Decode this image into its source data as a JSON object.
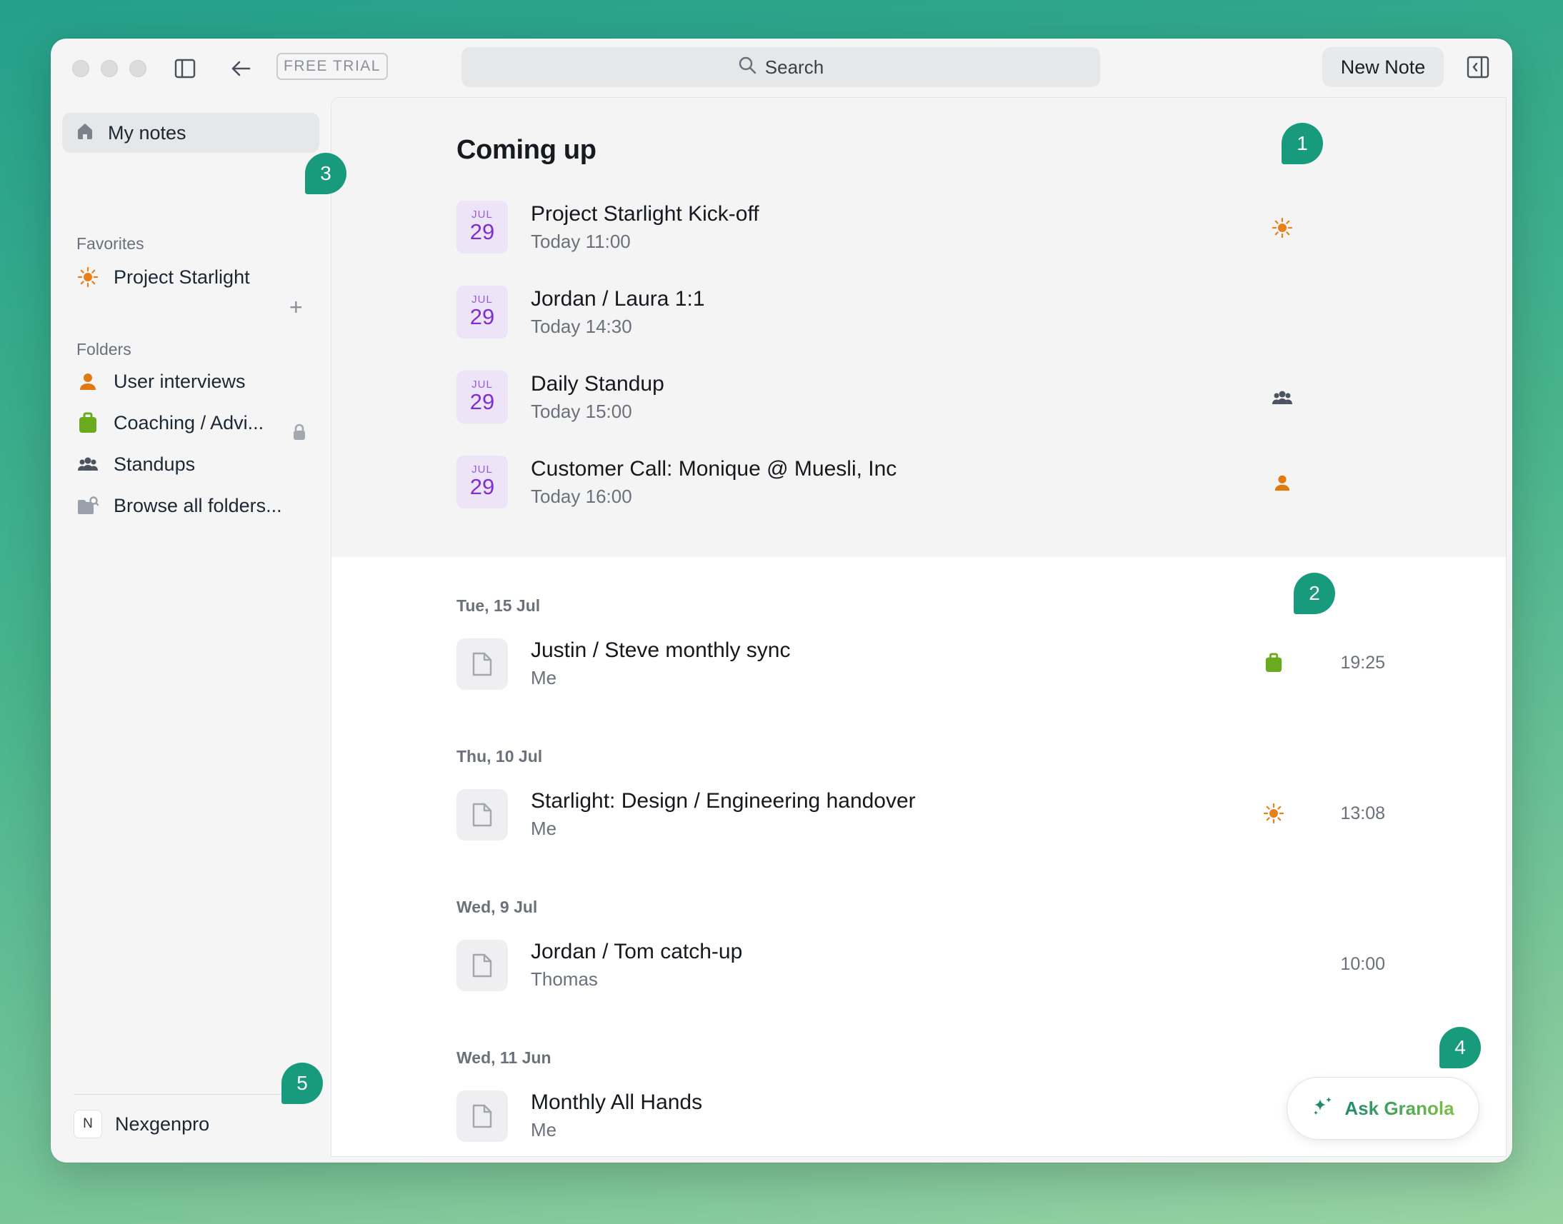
{
  "titlebar": {
    "badge": "FREE TRIAL",
    "search_label": "Search",
    "new_note_label": "New Note"
  },
  "sidebar": {
    "my_notes": "My notes",
    "favorites_title": "Favorites",
    "favorites": [
      {
        "label": "Project Starlight",
        "icon": "sun-icon"
      }
    ],
    "folders_title": "Folders",
    "folders": [
      {
        "label": "User interviews",
        "icon": "person-icon"
      },
      {
        "label": "Coaching / Advi...",
        "icon": "briefcase-icon",
        "locked": true
      },
      {
        "label": "Standups",
        "icon": "group-icon"
      },
      {
        "label": "Browse all folders...",
        "icon": "folder-search-icon"
      }
    ],
    "workspace_initial": "N",
    "workspace_name": "Nexgenpro"
  },
  "coming_up": {
    "title": "Coming up",
    "events": [
      {
        "month": "JUL",
        "day": "29",
        "title": "Project Starlight Kick-off",
        "time": "Today 11:00",
        "icon": "sun-icon"
      },
      {
        "month": "JUL",
        "day": "29",
        "title": "Jordan / Laura 1:1",
        "time": "Today 14:30",
        "icon": ""
      },
      {
        "month": "JUL",
        "day": "29",
        "title": "Daily Standup",
        "time": "Today 15:00",
        "icon": "group-icon"
      },
      {
        "month": "JUL",
        "day": "29",
        "title": "Customer Call: Monique @ Muesli, Inc",
        "time": "Today 16:00",
        "icon": "person-icon"
      }
    ]
  },
  "notes": [
    {
      "date": "Tue, 15 Jul",
      "title": "Justin / Steve monthly sync",
      "author": "Me",
      "time": "19:25",
      "icon": "briefcase-icon"
    },
    {
      "date": "Thu, 10 Jul",
      "title": "Starlight: Design / Engineering handover",
      "author": "Me",
      "time": "13:08",
      "icon": "sun-icon"
    },
    {
      "date": "Wed, 9 Jul",
      "title": "Jordan / Tom catch-up",
      "author": "Thomas",
      "time": "10:00",
      "icon": ""
    },
    {
      "date": "Wed, 11 Jun",
      "title": "Monthly All Hands",
      "author": "Me",
      "time": "",
      "icon": ""
    }
  ],
  "ask_button": "Ask Granola",
  "markers": [
    "1",
    "2",
    "3",
    "4",
    "5"
  ],
  "colors": {
    "accent_marker": "#189a7c",
    "calendar_purple": "#7f2fd0",
    "sun_orange": "#e8801a",
    "person_orange": "#e07a10",
    "briefcase_green": "#6aaa1e"
  }
}
